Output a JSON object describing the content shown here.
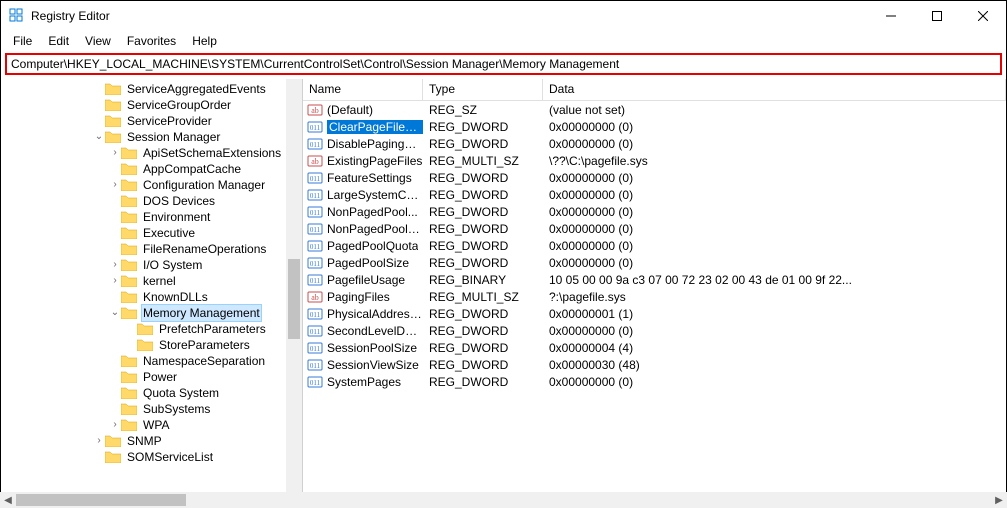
{
  "window": {
    "title": "Registry Editor"
  },
  "menu": {
    "file": "File",
    "edit": "Edit",
    "view": "View",
    "favorites": "Favorites",
    "help": "Help"
  },
  "address": "Computer\\HKEY_LOCAL_MACHINE\\SYSTEM\\CurrentControlSet\\Control\\Session Manager\\Memory Management",
  "tree": {
    "items": [
      {
        "indent": 2,
        "twisty": "",
        "label": "ServiceAggregatedEvents",
        "selected": false
      },
      {
        "indent": 2,
        "twisty": "",
        "label": "ServiceGroupOrder",
        "selected": false
      },
      {
        "indent": 2,
        "twisty": "",
        "label": "ServiceProvider",
        "selected": false
      },
      {
        "indent": 2,
        "twisty": "v",
        "label": "Session Manager",
        "selected": false
      },
      {
        "indent": 3,
        "twisty": ">",
        "label": "ApiSetSchemaExtensions",
        "selected": false
      },
      {
        "indent": 3,
        "twisty": "",
        "label": "AppCompatCache",
        "selected": false
      },
      {
        "indent": 3,
        "twisty": ">",
        "label": "Configuration Manager",
        "selected": false
      },
      {
        "indent": 3,
        "twisty": "",
        "label": "DOS Devices",
        "selected": false
      },
      {
        "indent": 3,
        "twisty": "",
        "label": "Environment",
        "selected": false
      },
      {
        "indent": 3,
        "twisty": "",
        "label": "Executive",
        "selected": false
      },
      {
        "indent": 3,
        "twisty": "",
        "label": "FileRenameOperations",
        "selected": false
      },
      {
        "indent": 3,
        "twisty": ">",
        "label": "I/O System",
        "selected": false
      },
      {
        "indent": 3,
        "twisty": ">",
        "label": "kernel",
        "selected": false
      },
      {
        "indent": 3,
        "twisty": "",
        "label": "KnownDLLs",
        "selected": false
      },
      {
        "indent": 3,
        "twisty": "v",
        "label": "Memory Management",
        "selected": true
      },
      {
        "indent": 4,
        "twisty": "",
        "label": "PrefetchParameters",
        "selected": false
      },
      {
        "indent": 4,
        "twisty": "",
        "label": "StoreParameters",
        "selected": false
      },
      {
        "indent": 3,
        "twisty": "",
        "label": "NamespaceSeparation",
        "selected": false
      },
      {
        "indent": 3,
        "twisty": "",
        "label": "Power",
        "selected": false
      },
      {
        "indent": 3,
        "twisty": "",
        "label": "Quota System",
        "selected": false
      },
      {
        "indent": 3,
        "twisty": "",
        "label": "SubSystems",
        "selected": false
      },
      {
        "indent": 3,
        "twisty": ">",
        "label": "WPA",
        "selected": false
      },
      {
        "indent": 2,
        "twisty": ">",
        "label": "SNMP",
        "selected": false
      },
      {
        "indent": 2,
        "twisty": "",
        "label": "SOMServiceList",
        "selected": false
      }
    ]
  },
  "list": {
    "headers": {
      "name": "Name",
      "type": "Type",
      "data": "Data"
    },
    "rows": [
      {
        "icon": "sz",
        "name": "(Default)",
        "type": "REG_SZ",
        "data": "(value not set)",
        "selected": false
      },
      {
        "icon": "bin",
        "name": "ClearPageFileAt...",
        "type": "REG_DWORD",
        "data": "0x00000000 (0)",
        "selected": true
      },
      {
        "icon": "bin",
        "name": "DisablePagingEx...",
        "type": "REG_DWORD",
        "data": "0x00000000 (0)",
        "selected": false
      },
      {
        "icon": "sz",
        "name": "ExistingPageFiles",
        "type": "REG_MULTI_SZ",
        "data": "\\??\\C:\\pagefile.sys",
        "selected": false
      },
      {
        "icon": "bin",
        "name": "FeatureSettings",
        "type": "REG_DWORD",
        "data": "0x00000000 (0)",
        "selected": false
      },
      {
        "icon": "bin",
        "name": "LargeSystemCac...",
        "type": "REG_DWORD",
        "data": "0x00000000 (0)",
        "selected": false
      },
      {
        "icon": "bin",
        "name": "NonPagedPool...",
        "type": "REG_DWORD",
        "data": "0x00000000 (0)",
        "selected": false
      },
      {
        "icon": "bin",
        "name": "NonPagedPoolS...",
        "type": "REG_DWORD",
        "data": "0x00000000 (0)",
        "selected": false
      },
      {
        "icon": "bin",
        "name": "PagedPoolQuota",
        "type": "REG_DWORD",
        "data": "0x00000000 (0)",
        "selected": false
      },
      {
        "icon": "bin",
        "name": "PagedPoolSize",
        "type": "REG_DWORD",
        "data": "0x00000000 (0)",
        "selected": false
      },
      {
        "icon": "bin",
        "name": "PagefileUsage",
        "type": "REG_BINARY",
        "data": "10 05 00 00 9a c3 07 00 72 23 02 00 43 de 01 00 9f 22...",
        "selected": false
      },
      {
        "icon": "sz",
        "name": "PagingFiles",
        "type": "REG_MULTI_SZ",
        "data": "?:\\pagefile.sys",
        "selected": false
      },
      {
        "icon": "bin",
        "name": "PhysicalAddress...",
        "type": "REG_DWORD",
        "data": "0x00000001 (1)",
        "selected": false
      },
      {
        "icon": "bin",
        "name": "SecondLevelDat...",
        "type": "REG_DWORD",
        "data": "0x00000000 (0)",
        "selected": false
      },
      {
        "icon": "bin",
        "name": "SessionPoolSize",
        "type": "REG_DWORD",
        "data": "0x00000004 (4)",
        "selected": false
      },
      {
        "icon": "bin",
        "name": "SessionViewSize",
        "type": "REG_DWORD",
        "data": "0x00000030 (48)",
        "selected": false
      },
      {
        "icon": "bin",
        "name": "SystemPages",
        "type": "REG_DWORD",
        "data": "0x00000000 (0)",
        "selected": false
      }
    ]
  }
}
